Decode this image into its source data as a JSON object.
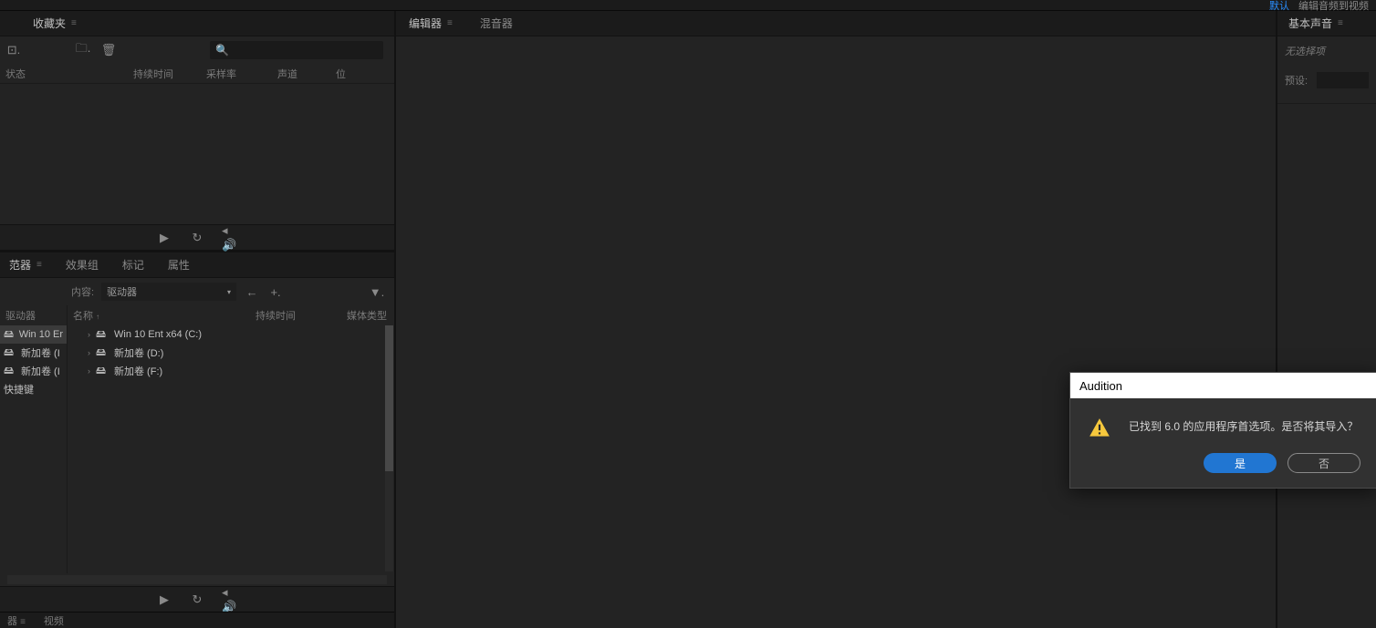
{
  "topbar": {
    "default_link": "默认",
    "right_label": "编辑音频到视频"
  },
  "favorites_panel": {
    "tab": "收藏夹",
    "columns": {
      "status": "状态",
      "duration": "持续时间",
      "samplerate": "采样率",
      "channel": "声道",
      "bit": "位"
    }
  },
  "lower_panel": {
    "tabs": {
      "browser": "范器",
      "effects": "效果组",
      "markers": "标记",
      "properties": "属性"
    },
    "content_label": "内容:",
    "dropdown_value": "驱动器",
    "left_tree": {
      "header": "驱动器",
      "items": [
        {
          "label": "Win 10 Er"
        },
        {
          "label": "新加卷 (I"
        },
        {
          "label": "新加卷 (I"
        },
        {
          "label": "快捷键"
        }
      ]
    },
    "right_tree": {
      "name_header": "名称",
      "dur_header": "持续时间",
      "type_header": "媒体类型",
      "items": [
        {
          "label": "Win 10 Ent x64 (C:)"
        },
        {
          "label": "新加卷 (D:)"
        },
        {
          "label": "新加卷 (F:)"
        }
      ]
    }
  },
  "bottom": {
    "item1": "器",
    "item2": "视频"
  },
  "center": {
    "tab_editor": "编辑器",
    "tab_mixer": "混音器"
  },
  "right": {
    "tab": "基本声音",
    "no_selection": "无选择项",
    "preset_label": "预设:"
  },
  "dialog": {
    "title": "Audition",
    "message": "已找到  6.0 的应用程序首选项。是否将其导入？",
    "yes": "是",
    "no": "否"
  }
}
